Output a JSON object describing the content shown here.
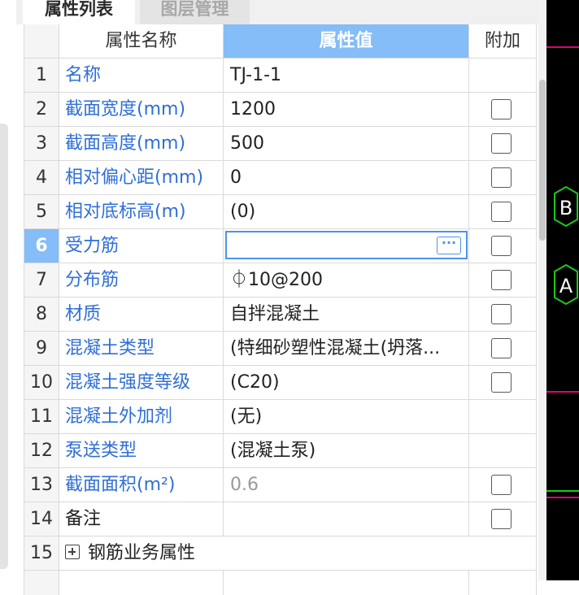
{
  "tabs": [
    {
      "label": "属性列表"
    },
    {
      "label": "图层管理"
    }
  ],
  "table": {
    "headers": {
      "name": "属性名称",
      "value": "属性值",
      "additional": "附加"
    },
    "rows": [
      {
        "num": "1",
        "name": "名称",
        "value": "TJ-1-1"
      },
      {
        "num": "2",
        "name": "截面宽度(mm)",
        "value": "1200"
      },
      {
        "num": "3",
        "name": "截面高度(mm)",
        "value": "500"
      },
      {
        "num": "4",
        "name": "相对偏心距(mm)",
        "value": "0"
      },
      {
        "num": "5",
        "name": "相对底标高(m)",
        "value": "(0)"
      },
      {
        "num": "6",
        "name": "受力筋",
        "value": ""
      },
      {
        "num": "7",
        "name": "分布筋",
        "value": "⏀10@200"
      },
      {
        "num": "8",
        "name": "材质",
        "value": "自拌混凝土"
      },
      {
        "num": "9",
        "name": "混凝土类型",
        "value": "(特细砂塑性混凝土(坍落..."
      },
      {
        "num": "10",
        "name": "混凝土强度等级",
        "value": "(C20)"
      },
      {
        "num": "11",
        "name": "混凝土外加剂",
        "value": "(无)"
      },
      {
        "num": "12",
        "name": "泵送类型",
        "value": "(混凝土泵)"
      },
      {
        "num": "13",
        "name": "截面面积(m²)",
        "value": "0.6"
      },
      {
        "num": "14",
        "name": "备注",
        "value": ""
      },
      {
        "num": "15",
        "name": "钢筋业务属性",
        "value": ""
      }
    ]
  },
  "editor": {
    "button_label": "···"
  },
  "canvas": {
    "labels": [
      "B",
      "A"
    ],
    "colors": {
      "axis_line": "#e0007a",
      "marker": "#1fc61f",
      "background": "#000000"
    }
  },
  "colors": {
    "accent": "#84bdf7",
    "link": "#2f6fd6",
    "focus": "#4b95e8"
  }
}
